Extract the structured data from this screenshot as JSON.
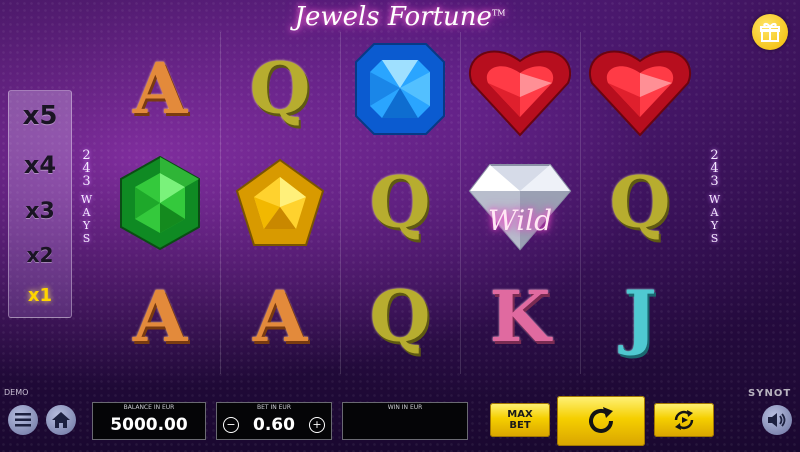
{
  "game": {
    "title": "Jewels Fortune",
    "trademark": "TM"
  },
  "multipliers": [
    "x5",
    "x4",
    "x3",
    "x2",
    "x1"
  ],
  "active_multiplier": "x1",
  "ways": {
    "number": "243",
    "label": "WAYS"
  },
  "reels": [
    [
      "A",
      "emerald",
      "A"
    ],
    [
      "Q",
      "topaz",
      "A"
    ],
    [
      "sapphire",
      "Q",
      "Q"
    ],
    [
      "ruby-heart",
      "diamond-wild",
      "K"
    ],
    [
      "ruby-heart",
      "Q",
      "J"
    ]
  ],
  "wild_label": "Wild",
  "footer": {
    "demo_label": "DEMO",
    "brand": "SYNOT",
    "balance": {
      "label": "BALANCE IN EUR",
      "value": "5000.00"
    },
    "bet": {
      "label": "BET IN EUR",
      "value": "0.60",
      "minus": "−",
      "plus": "+"
    },
    "win": {
      "label": "WIN IN EUR",
      "value": ""
    },
    "max_bet_line1": "MAX",
    "max_bet_line2": "BET"
  },
  "icons": {
    "menu": "menu-icon",
    "home": "home-icon",
    "spin": "spin-icon",
    "autoplay": "autoplay-icon",
    "sound": "speaker-icon",
    "gift": "gift-icon"
  },
  "colors": {
    "accent": "#f5cf00",
    "glow": "#ff6fd8",
    "background": "#2a0c45"
  }
}
